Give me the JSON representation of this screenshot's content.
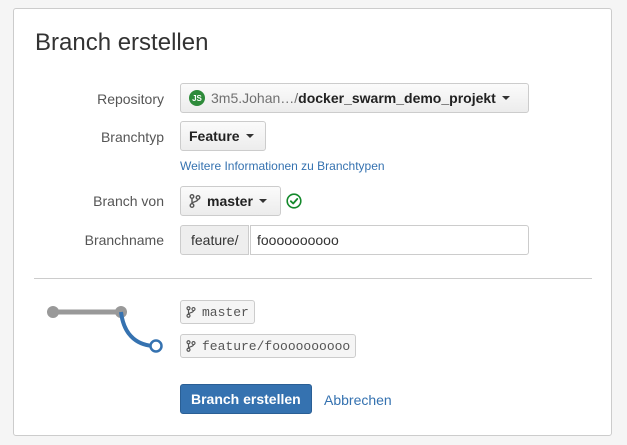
{
  "dialog": {
    "title": "Branch erstellen"
  },
  "form": {
    "repository": {
      "label": "Repository",
      "badge": "JS",
      "project": "3m5.Johan…",
      "separator": "/",
      "name": "docker_swarm_demo_projekt"
    },
    "branch_type": {
      "label": "Branchtyp",
      "value": "Feature",
      "info_link": "Weitere Informationen zu Branchtypen"
    },
    "branch_from": {
      "label": "Branch von",
      "value": "master",
      "status_icon": "check-circle-icon"
    },
    "branch_name": {
      "label": "Branchname",
      "prefix": "feature/",
      "value": "foooooooooo"
    }
  },
  "preview": {
    "source_branch": "master",
    "new_branch": "feature/foooooooooo",
    "colors": {
      "source_line": "#999999",
      "new_line": "#3572b0"
    }
  },
  "actions": {
    "submit_label": "Branch erstellen",
    "cancel_label": "Abbrechen"
  },
  "colors": {
    "primary": "#3572b0",
    "success": "#14892c"
  }
}
